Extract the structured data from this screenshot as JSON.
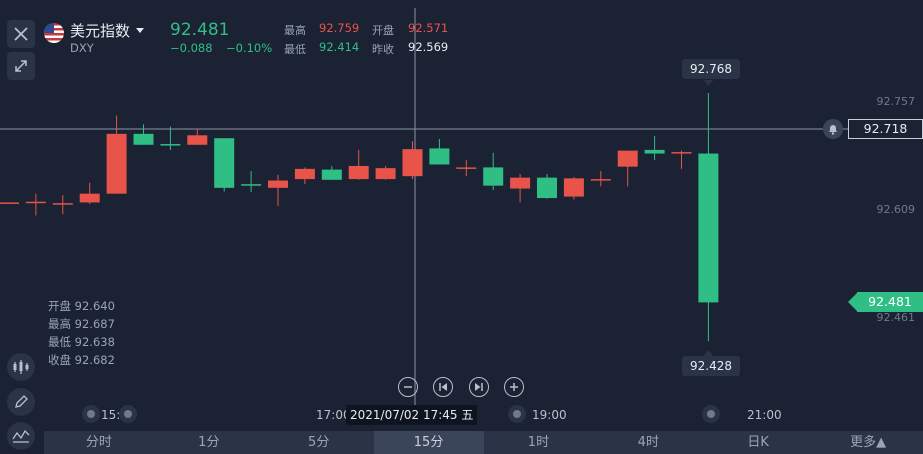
{
  "header": {
    "title": "美元指数",
    "symbol": "DXY",
    "price": "92.481",
    "change": "−0.088",
    "change_pct": "−0.10%",
    "high_label": "最高",
    "high_value": "92.759",
    "open_label": "开盘",
    "open_value": "92.571",
    "low_label": "最低",
    "low_value": "92.414",
    "prev_close_label": "昨收",
    "prev_close_value": "92.569"
  },
  "crosshair_ohlc": {
    "open": "开盘 92.640",
    "high": "最高 92.687",
    "low": "最低 92.638",
    "close": "收盘 92.682"
  },
  "price_tags": {
    "max": "92.768",
    "min": "92.428",
    "crosshair": "92.718",
    "current": "92.481"
  },
  "y_axis": [
    "92.757",
    "92.609",
    "92.461"
  ],
  "x_axis": {
    "label_1500": "15:00",
    "label_1700": "17:00",
    "label_1900": "19:00",
    "label_2100": "21:00",
    "crosshair_time": "2021/07/02 17:45 五"
  },
  "tabs": [
    "分时",
    "1分",
    "5分",
    "15分",
    "1时",
    "4时",
    "日K",
    "更多▲"
  ],
  "active_tab": "15分",
  "colors": {
    "up": "#e8534a",
    "down": "#2fbf85",
    "background": "#1a2233"
  },
  "chart_data": {
    "type": "candlestick",
    "series_note": "OHLC candles, red = rising, green = falling",
    "candles": [
      {
        "o": 92.618,
        "h": 92.618,
        "l": 92.618,
        "c": 92.618
      },
      {
        "o": 92.617,
        "h": 92.63,
        "l": 92.6,
        "c": 92.619
      },
      {
        "o": 92.617,
        "h": 92.628,
        "l": 92.602,
        "c": 92.617
      },
      {
        "o": 92.618,
        "h": 92.645,
        "l": 92.616,
        "c": 92.63
      },
      {
        "o": 92.63,
        "h": 92.737,
        "l": 92.63,
        "c": 92.712
      },
      {
        "o": 92.712,
        "h": 92.725,
        "l": 92.697,
        "c": 92.697
      },
      {
        "o": 92.698,
        "h": 92.722,
        "l": 92.69,
        "c": 92.696
      },
      {
        "o": 92.697,
        "h": 92.719,
        "l": 92.697,
        "c": 92.71
      },
      {
        "o": 92.706,
        "h": 92.706,
        "l": 92.633,
        "c": 92.638
      },
      {
        "o": 92.643,
        "h": 92.661,
        "l": 92.632,
        "c": 92.642
      },
      {
        "o": 92.638,
        "h": 92.656,
        "l": 92.613,
        "c": 92.648
      },
      {
        "o": 92.65,
        "h": 92.666,
        "l": 92.643,
        "c": 92.664
      },
      {
        "o": 92.663,
        "h": 92.668,
        "l": 92.649,
        "c": 92.649
      },
      {
        "o": 92.65,
        "h": 92.69,
        "l": 92.649,
        "c": 92.668
      },
      {
        "o": 92.65,
        "h": 92.668,
        "l": 92.649,
        "c": 92.665
      },
      {
        "o": 92.654,
        "h": 92.702,
        "l": 92.65,
        "c": 92.691
      },
      {
        "o": 92.692,
        "h": 92.705,
        "l": 92.671,
        "c": 92.67
      },
      {
        "o": 92.666,
        "h": 92.676,
        "l": 92.654,
        "c": 92.666
      },
      {
        "o": 92.666,
        "h": 92.686,
        "l": 92.635,
        "c": 92.641
      },
      {
        "o": 92.637,
        "h": 92.657,
        "l": 92.618,
        "c": 92.652
      },
      {
        "o": 92.652,
        "h": 92.657,
        "l": 92.623,
        "c": 92.624
      },
      {
        "o": 92.626,
        "h": 92.653,
        "l": 92.622,
        "c": 92.651
      },
      {
        "o": 92.648,
        "h": 92.661,
        "l": 92.64,
        "c": 92.65
      },
      {
        "o": 92.667,
        "h": 92.688,
        "l": 92.64,
        "c": 92.689
      },
      {
        "o": 92.69,
        "h": 92.709,
        "l": 92.676,
        "c": 92.685
      },
      {
        "o": 92.685,
        "h": 92.689,
        "l": 92.664,
        "c": 92.687
      },
      {
        "o": 92.685,
        "h": 92.768,
        "l": 92.428,
        "c": 92.481
      }
    ]
  }
}
